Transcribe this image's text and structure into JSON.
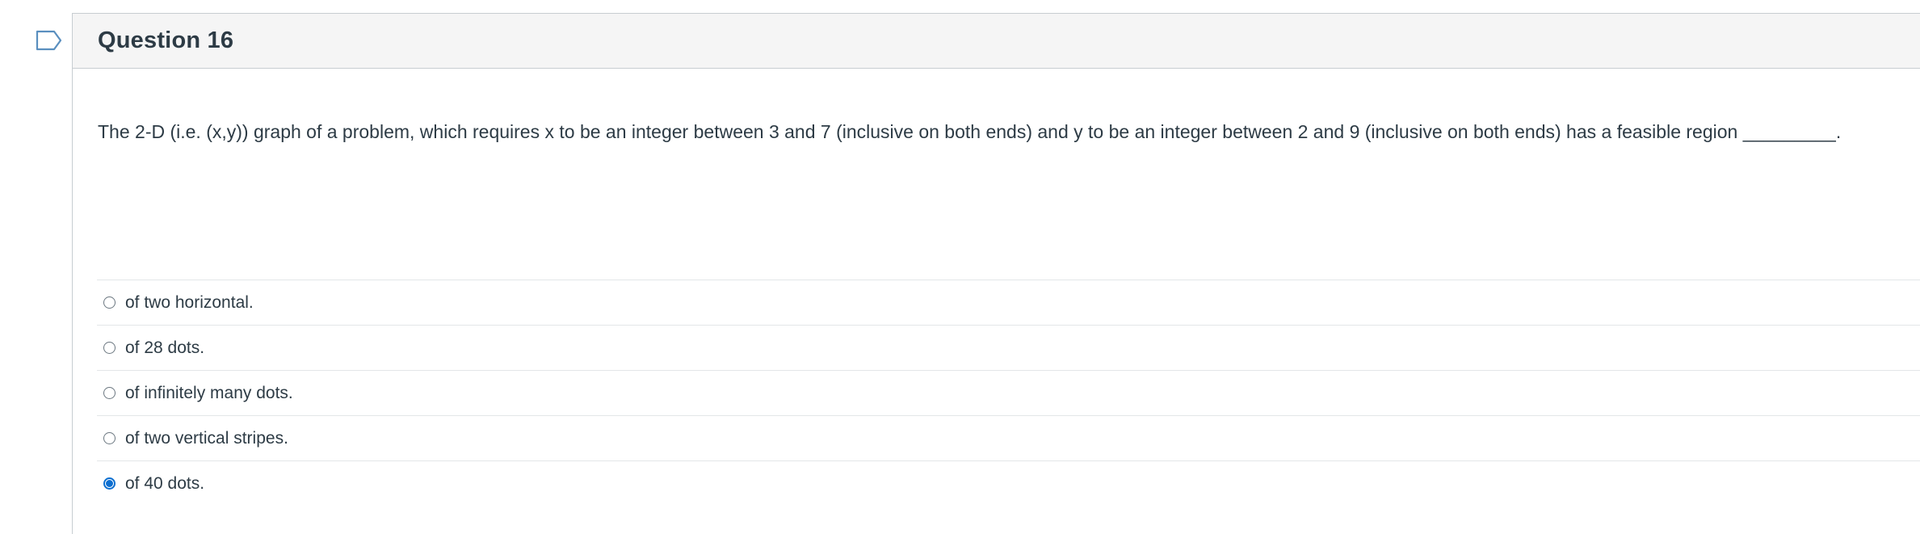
{
  "question": {
    "title": "Question 16",
    "text": "The 2-D (i.e. (x,y)) graph of a problem, which requires x to be an integer between 3 and 7 (inclusive on both ends) and y to be an integer between 2 and 9 (inclusive on both ends) has a feasible region _________.",
    "answers": [
      {
        "label": "of two horizontal.",
        "selected": false
      },
      {
        "label": "of 28 dots.",
        "selected": false
      },
      {
        "label": "of infinitely many dots.",
        "selected": false
      },
      {
        "label": "of two vertical stripes.",
        "selected": false
      },
      {
        "label": "of 40 dots.",
        "selected": true
      }
    ]
  },
  "colors": {
    "accent": "#0b6ed0",
    "flag_outline": "#5a8fbf",
    "header_bg": "#f5f5f5",
    "border": "#c7cdd1",
    "text": "#2d3b45"
  },
  "icons": {
    "flag": "flag-question-icon"
  }
}
